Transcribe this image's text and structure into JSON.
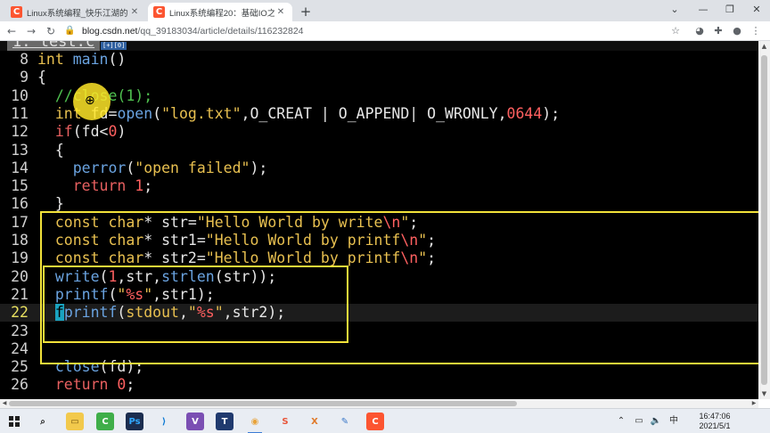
{
  "browser": {
    "tabs": [
      {
        "title": "Linux系统编程_快乐江湖的博客-",
        "favicon": "C"
      },
      {
        "title": "Linux系统编程20：基础IO之从",
        "favicon": "C"
      }
    ],
    "new_tab_symbol": "+",
    "window_controls": {
      "dropdown": "⌄",
      "minimize": "—",
      "restore": "❐",
      "close": "✕"
    },
    "nav": {
      "back": "←",
      "forward": "→",
      "reload": "↻"
    },
    "url_host": "blog.csdn.net",
    "url_path": "/qq_39183034/article/details/116232824",
    "toolbar_icons": [
      "star-icon",
      "extension-shield-icon",
      "puzzle-icon",
      "profile-icon",
      "menu-icon"
    ]
  },
  "vim": {
    "tab_label": "1: test.c",
    "tab_badge": "[+][0]",
    "lines": [
      {
        "num": "8",
        "tokens": [
          {
            "t": "int",
            "c": "type"
          },
          {
            "t": " ",
            "c": "pl"
          },
          {
            "t": "main",
            "c": "fn"
          },
          {
            "t": "()",
            "c": "pl"
          }
        ]
      },
      {
        "num": "9",
        "tokens": [
          {
            "t": "{",
            "c": "pl"
          }
        ]
      },
      {
        "num": "10",
        "tokens": [
          {
            "t": "  ",
            "c": "pl"
          },
          {
            "t": "//close(1);",
            "c": "cmt"
          }
        ]
      },
      {
        "num": "11",
        "tokens": [
          {
            "t": "  ",
            "c": "pl"
          },
          {
            "t": "int",
            "c": "type"
          },
          {
            "t": " fd=",
            "c": "pl"
          },
          {
            "t": "open",
            "c": "fn"
          },
          {
            "t": "(",
            "c": "pl"
          },
          {
            "t": "\"log.txt\"",
            "c": "str"
          },
          {
            "t": ",O_CREAT | O_APPEND| O_WRONLY,",
            "c": "pl"
          },
          {
            "t": "0644",
            "c": "num"
          },
          {
            "t": ");",
            "c": "pl"
          }
        ]
      },
      {
        "num": "12",
        "tokens": [
          {
            "t": "  ",
            "c": "pl"
          },
          {
            "t": "if",
            "c": "kw"
          },
          {
            "t": "(fd<",
            "c": "pl"
          },
          {
            "t": "0",
            "c": "num"
          },
          {
            "t": ")",
            "c": "pl"
          }
        ]
      },
      {
        "num": "13",
        "tokens": [
          {
            "t": "  {",
            "c": "pl"
          }
        ]
      },
      {
        "num": "14",
        "tokens": [
          {
            "t": "    ",
            "c": "pl"
          },
          {
            "t": "perror",
            "c": "fn"
          },
          {
            "t": "(",
            "c": "pl"
          },
          {
            "t": "\"open failed\"",
            "c": "str"
          },
          {
            "t": ");",
            "c": "pl"
          }
        ]
      },
      {
        "num": "15",
        "tokens": [
          {
            "t": "    ",
            "c": "pl"
          },
          {
            "t": "return",
            "c": "kw"
          },
          {
            "t": " ",
            "c": "pl"
          },
          {
            "t": "1",
            "c": "num"
          },
          {
            "t": ";",
            "c": "pl"
          }
        ]
      },
      {
        "num": "16",
        "tokens": [
          {
            "t": "  }",
            "c": "pl"
          }
        ]
      },
      {
        "num": "17",
        "tokens": [
          {
            "t": "  ",
            "c": "pl"
          },
          {
            "t": "const",
            "c": "type"
          },
          {
            "t": " ",
            "c": "pl"
          },
          {
            "t": "char",
            "c": "type"
          },
          {
            "t": "* str=",
            "c": "pl"
          },
          {
            "t": "\"Hello World by write",
            "c": "str"
          },
          {
            "t": "\\n",
            "c": "esc"
          },
          {
            "t": "\"",
            "c": "str"
          },
          {
            "t": ";",
            "c": "pl"
          }
        ]
      },
      {
        "num": "18",
        "tokens": [
          {
            "t": "  ",
            "c": "pl"
          },
          {
            "t": "const",
            "c": "type"
          },
          {
            "t": " ",
            "c": "pl"
          },
          {
            "t": "char",
            "c": "type"
          },
          {
            "t": "* str1=",
            "c": "pl"
          },
          {
            "t": "\"Hello World by printf",
            "c": "str"
          },
          {
            "t": "\\n",
            "c": "esc"
          },
          {
            "t": "\"",
            "c": "str"
          },
          {
            "t": ";",
            "c": "pl"
          }
        ]
      },
      {
        "num": "19",
        "tokens": [
          {
            "t": "  ",
            "c": "pl"
          },
          {
            "t": "const",
            "c": "type"
          },
          {
            "t": " ",
            "c": "pl"
          },
          {
            "t": "char",
            "c": "type"
          },
          {
            "t": "* str2=",
            "c": "pl"
          },
          {
            "t": "\"Hello World by printf",
            "c": "str"
          },
          {
            "t": "\\n",
            "c": "esc"
          },
          {
            "t": "\"",
            "c": "str"
          },
          {
            "t": ";",
            "c": "pl"
          }
        ]
      },
      {
        "num": "20",
        "tokens": [
          {
            "t": "  ",
            "c": "pl"
          },
          {
            "t": "write",
            "c": "fn"
          },
          {
            "t": "(",
            "c": "pl"
          },
          {
            "t": "1",
            "c": "num"
          },
          {
            "t": ",str,",
            "c": "pl"
          },
          {
            "t": "strlen",
            "c": "fn"
          },
          {
            "t": "(str));",
            "c": "pl"
          }
        ]
      },
      {
        "num": "21",
        "tokens": [
          {
            "t": "  ",
            "c": "pl"
          },
          {
            "t": "printf",
            "c": "fn"
          },
          {
            "t": "(",
            "c": "pl"
          },
          {
            "t": "\"",
            "c": "str"
          },
          {
            "t": "%s",
            "c": "esc"
          },
          {
            "t": "\"",
            "c": "str"
          },
          {
            "t": ",str1);",
            "c": "pl"
          }
        ]
      },
      {
        "num": "22",
        "current": true,
        "tokens": [
          {
            "t": "  ",
            "c": "pl"
          },
          {
            "t": "f",
            "c": "cursor"
          },
          {
            "t": "printf",
            "c": "fn"
          },
          {
            "t": "(",
            "c": "pl"
          },
          {
            "t": "stdout",
            "c": "type"
          },
          {
            "t": ",",
            "c": "pl"
          },
          {
            "t": "\"",
            "c": "str"
          },
          {
            "t": "%s",
            "c": "esc"
          },
          {
            "t": "\"",
            "c": "str"
          },
          {
            "t": ",str2);",
            "c": "pl"
          }
        ]
      },
      {
        "num": "23",
        "tokens": []
      },
      {
        "num": "24",
        "tokens": []
      },
      {
        "num": "25",
        "tokens": [
          {
            "t": "  ",
            "c": "pl"
          },
          {
            "t": "close",
            "c": "fn"
          },
          {
            "t": "(fd);",
            "c": "pl"
          }
        ]
      },
      {
        "num": "26",
        "tokens": [
          {
            "t": "  ",
            "c": "pl"
          },
          {
            "t": "return",
            "c": "kw"
          },
          {
            "t": " ",
            "c": "pl"
          },
          {
            "t": "0",
            "c": "num"
          },
          {
            "t": ";",
            "c": "pl"
          }
        ]
      }
    ]
  },
  "taskbar": {
    "apps": [
      {
        "name": "search-app",
        "glyph": "⌕",
        "color": "#e9edf3",
        "fg": "#222222"
      },
      {
        "name": "file-explorer-app",
        "glyph": "▭",
        "color": "#f2c94c",
        "fg": "#7a5a10"
      },
      {
        "name": "camtasia-app",
        "glyph": "C",
        "color": "#3fae49",
        "fg": "#ffffff"
      },
      {
        "name": "photoshop-app",
        "glyph": "Ps",
        "color": "#1b2d4f",
        "fg": "#31a8ff"
      },
      {
        "name": "vscode-app",
        "glyph": "⟩",
        "color": "#e9edf3",
        "fg": "#0a78d4"
      },
      {
        "name": "visual-studio-app",
        "glyph": "V",
        "color": "#7b4fb3",
        "fg": "#ffffff"
      },
      {
        "name": "typora-app",
        "glyph": "T",
        "color": "#203a6e",
        "fg": "#ffffff"
      },
      {
        "name": "chrome-app",
        "glyph": "◉",
        "color": "#e9edf3",
        "fg": "#e8a33a"
      },
      {
        "name": "sublime-app",
        "glyph": "S",
        "color": "#e9edf3",
        "fg": "#e8563a"
      },
      {
        "name": "xmind-app",
        "glyph": "X",
        "color": "#e9edf3",
        "fg": "#e07a2a"
      },
      {
        "name": "notepad-app",
        "glyph": "✎",
        "color": "#e9edf3",
        "fg": "#3a78c8"
      },
      {
        "name": "csdn-app",
        "glyph": "C",
        "color": "#fc5531",
        "fg": "#ffffff"
      }
    ],
    "tray": [
      "chevron-up-icon",
      "network-icon",
      "volume-icon",
      "ime-icon"
    ],
    "tray_glyphs": [
      "⌃",
      "▭",
      "🔈",
      "中"
    ],
    "time": "16:47:06",
    "date": "2021/5/1"
  }
}
